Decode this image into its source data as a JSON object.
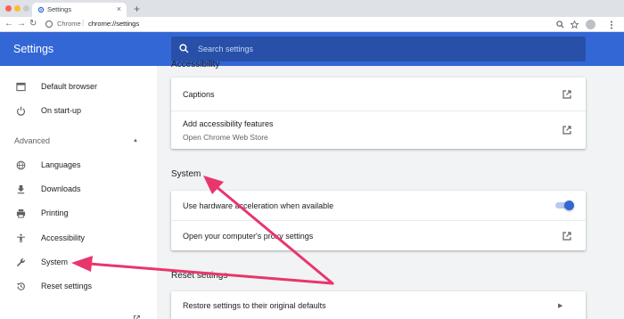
{
  "browser": {
    "tab_title": "Settings",
    "tab_close": "×",
    "new_tab": "+",
    "omnibox_scheme": "Chrome",
    "omnibox_separator": "|",
    "omnibox_url": "chrome://settings",
    "nav": {
      "back": "←",
      "forward": "→",
      "reload": "↻"
    },
    "icons": [
      "search-icon",
      "star-icon",
      "avatar",
      "menu-icon"
    ]
  },
  "header": {
    "title": "Settings",
    "search_placeholder": "Search settings",
    "background": "#3367d6"
  },
  "sidebar": {
    "items_top": [
      {
        "label": "Default browser",
        "icon": "browser-icon"
      },
      {
        "label": "On start-up",
        "icon": "power-icon"
      }
    ],
    "advanced_label": "Advanced",
    "advanced_items": [
      {
        "label": "Languages",
        "icon": "globe-icon"
      },
      {
        "label": "Downloads",
        "icon": "download-icon"
      },
      {
        "label": "Printing",
        "icon": "printer-icon"
      },
      {
        "label": "Accessibility",
        "icon": "accessibility-icon"
      },
      {
        "label": "System",
        "icon": "wrench-icon"
      },
      {
        "label": "Reset settings",
        "icon": "history-icon"
      }
    ]
  },
  "main": {
    "accessibility": {
      "title": "Accessibility",
      "rows": [
        {
          "label": "Captions"
        },
        {
          "label": "Add accessibility features",
          "sublabel": "Open Chrome Web Store"
        }
      ]
    },
    "system": {
      "title": "System",
      "rows": [
        {
          "label": "Use hardware acceleration when available",
          "toggle_on": true
        },
        {
          "label": "Open your computer's proxy settings"
        }
      ]
    },
    "reset": {
      "title": "Reset settings",
      "rows": [
        {
          "label": "Restore settings to their original defaults"
        }
      ]
    }
  },
  "colors": {
    "accent": "#3367d6",
    "annotation_arrow": "#e8366c"
  }
}
